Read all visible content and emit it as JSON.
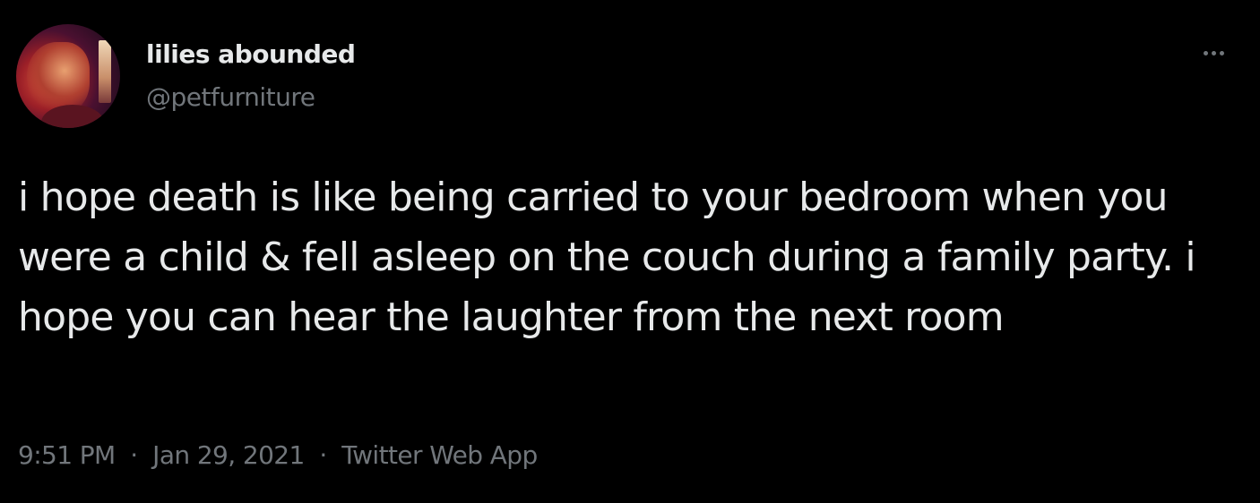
{
  "tweet": {
    "display_name": "lilies abounded",
    "handle": "@petfurniture",
    "avatar_icon": "profile-photo",
    "more_icon": "ellipsis-horizontal-icon",
    "text": "i hope death is like being carried to your bedroom when you were a child & fell asleep on the couch during a family party. i hope you can hear the laughter from the next room",
    "time": "9:51 PM",
    "separator": "·",
    "date": "Jan 29, 2021",
    "source": "Twitter Web App"
  },
  "colors": {
    "background": "#000000",
    "primary_text": "#e7e9ea",
    "secondary_text": "#71767b"
  }
}
